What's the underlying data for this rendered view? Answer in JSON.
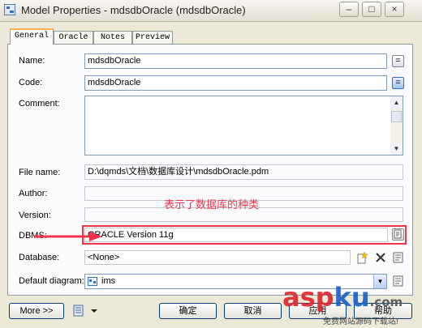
{
  "window": {
    "title": "Model Properties - mdsdbOracle (mdsdbOracle)",
    "controls": [
      "–",
      "□",
      "×"
    ]
  },
  "tabs": [
    "General",
    "Oracle",
    "Notes",
    "Preview"
  ],
  "form": {
    "name_label": "Name:",
    "name_value": "mdsdbOracle",
    "code_label": "Code:",
    "code_value": "mdsdbOracle",
    "comment_label": "Comment:",
    "comment_value": "",
    "filename_label": "File name:",
    "filename_value": "D:\\dqmds\\文档\\数据库设计\\mdsdbOracle.pdm",
    "author_label": "Author:",
    "author_value": "",
    "version_label": "Version:",
    "version_value": "",
    "dbms_label": "DBMS:",
    "dbms_value": "ORACLE Version 11g",
    "database_label": "Database:",
    "database_value": "<None>",
    "diagram_label": "Default diagram:",
    "diagram_value": "ims",
    "equals_glyph": "="
  },
  "annotation": {
    "text": "表示了数据库的种类",
    "color": "#f2334a"
  },
  "buttons": {
    "more": "More >>",
    "ok": "确定",
    "cancel": "取消",
    "apply": "应用",
    "help": "帮助"
  },
  "watermark": {
    "brand_red": "asp",
    "brand_blue": "ku",
    "brand_suffix": ".com",
    "tagline": "免费网站源码下载站!"
  }
}
